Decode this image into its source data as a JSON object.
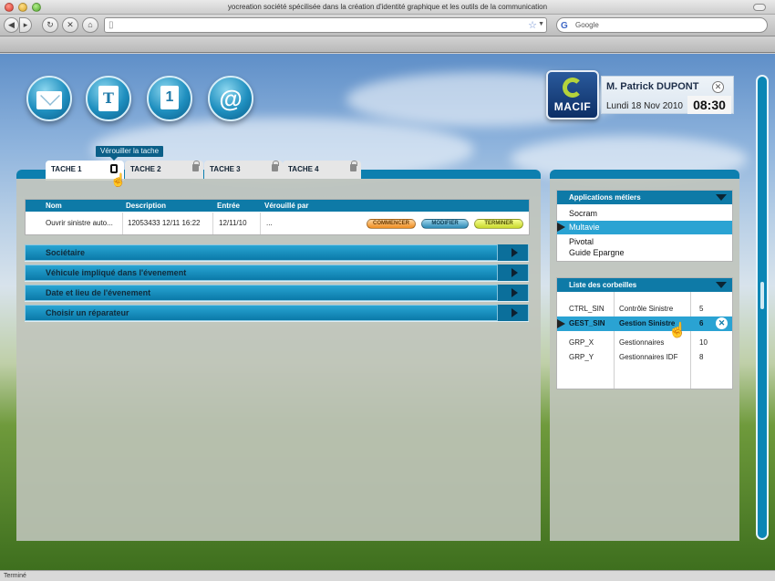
{
  "browser": {
    "title": "yocreation société spécilisée dans la création d'identité graphique et les outils de la communication",
    "search_placeholder": "Google",
    "status": "Terminé"
  },
  "app_icons": [
    {
      "name": "mail-icon",
      "glyph": ""
    },
    {
      "name": "document-icon",
      "glyph": "T"
    },
    {
      "name": "calendar-icon",
      "glyph": "1"
    },
    {
      "name": "web-icon",
      "glyph": "@"
    }
  ],
  "user": {
    "brand": "MACIF",
    "name": "M. Patrick DUPONT",
    "date": "Lundi 18 Nov 2010",
    "time": "08:30",
    "close_glyph": "✕"
  },
  "tooltip": "Vérouiller la tache",
  "tabs": [
    "TACHE 1",
    "TACHE 2",
    "TACHE 3",
    "TACHE 4"
  ],
  "task_table": {
    "headers": [
      "Nom",
      "Description",
      "Entrée",
      "Vérouillé par"
    ],
    "row": {
      "nom": "Ouvrir sinistre auto...",
      "description": "12053433 12/11 16:22",
      "entree": "12/11/10",
      "verrouille": "...",
      "buttons": [
        "COMMENCER",
        "MODIFIER",
        "TERMINER"
      ]
    }
  },
  "accordions": [
    "Sociétaire",
    "Véhicule impliqué dans l'évenement",
    "Date et lieu de l'évenement",
    "Choisir un réparateur"
  ],
  "apps": {
    "title": "Applications métiers",
    "items": [
      "Socram",
      "Multavie",
      "Pivotal",
      "Guide Epargne"
    ],
    "selected_index": 1
  },
  "corbeilles": {
    "title": "Liste des corbeilles",
    "rows": [
      {
        "code": "CTRL_SIN",
        "label": "Contrôle Sinistre",
        "count": "5"
      },
      {
        "code": "GEST_SIN",
        "label": "Gestion Sinistre",
        "count": "6"
      },
      {
        "code": "GRP_X",
        "label": "Gestionnaires",
        "count": "10"
      },
      {
        "code": "GRP_Y",
        "label": "Gestionnaires IDF",
        "count": "8"
      }
    ],
    "selected_index": 1
  },
  "colors": {
    "accent": "#0e7aa7",
    "highlight": "#2aa3d3",
    "commencer": "#ef8d1f",
    "modifier": "#2b89b4",
    "terminer": "#c8d82a"
  }
}
